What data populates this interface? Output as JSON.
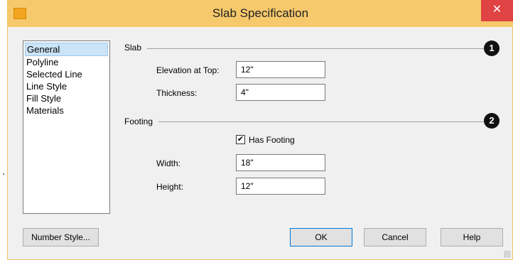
{
  "window": {
    "title": "Slab Specification",
    "close_glyph": "✕",
    "accent_color": "#f6c96c",
    "close_color": "#e04343",
    "app_icon": "app-icon"
  },
  "sidebar": {
    "items": [
      {
        "label": "General",
        "selected": true
      },
      {
        "label": "Polyline",
        "selected": false
      },
      {
        "label": "Selected Line",
        "selected": false
      },
      {
        "label": "Line Style",
        "selected": false
      },
      {
        "label": "Fill Style",
        "selected": false
      },
      {
        "label": "Materials",
        "selected": false
      }
    ]
  },
  "slab": {
    "group_label": "Slab",
    "badge": "1",
    "elevation_label": "Elevation at Top:",
    "elevation_value": "12\"",
    "thickness_label": "Thickness:",
    "thickness_value": "4\""
  },
  "footing": {
    "group_label": "Footing",
    "badge": "2",
    "has_footing_label": "Has Footing",
    "has_footing_checked": true,
    "check_glyph": "✔",
    "width_label": "Width:",
    "width_value": "18\"",
    "height_label": "Height:",
    "height_value": "12\""
  },
  "buttons": {
    "number_style": "Number Style...",
    "ok": "OK",
    "cancel": "Cancel",
    "help": "Help"
  }
}
